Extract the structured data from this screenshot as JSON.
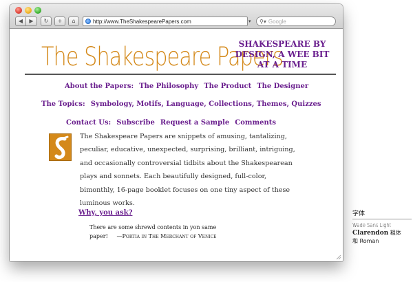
{
  "browser": {
    "url": "http://www.TheShakespearePapers.com",
    "search_placeholder": "Google",
    "back_icon": "back-arrow-icon",
    "forward_icon": "forward-arrow-icon"
  },
  "site": {
    "logo": "The Shakespeare Papers",
    "tagline": "SHAKESPEARE BY DESIGN, A WEE BIT AT A TIME",
    "nav_row1": {
      "label": "About the Papers:",
      "links": [
        "The Philosophy",
        "The Product",
        "The Designer"
      ]
    },
    "nav_row2": {
      "label": "The Topics:",
      "links": [
        "Symbology, Motifs, Language, Collections, Themes, Quizzes"
      ]
    },
    "nav_row3": {
      "label": "Contact Us:",
      "links": [
        "Subscribe",
        "Request a Sample",
        "Comments"
      ]
    },
    "body": "The Shakespeare Papers are snippets of amusing, tantalizing, peculiar, educative, unexpected, surprising, brilliant, intriguing, and occasionally controversial tidbits about the Shakespearean plays and sonnets. Each beautifully designed, full-color, bimonthly, 16-page booklet focuses on one tiny aspect of these luminous works.",
    "why_link": "Why, you ask?",
    "quote_line1": "There are some shrewd contents in yon same",
    "quote_line2": "paper!",
    "quote_attribution": "—Portia in The Merchant of Venice"
  },
  "caption": {
    "title": "字体",
    "line1": "Wade Sans Light",
    "line2_bold": "Clarendon",
    "line2_suffix": " 粗体",
    "line3": "和 Roman"
  },
  "colors": {
    "accent_purple": "#6a1f8e",
    "logo_orange": "#d4891a"
  }
}
